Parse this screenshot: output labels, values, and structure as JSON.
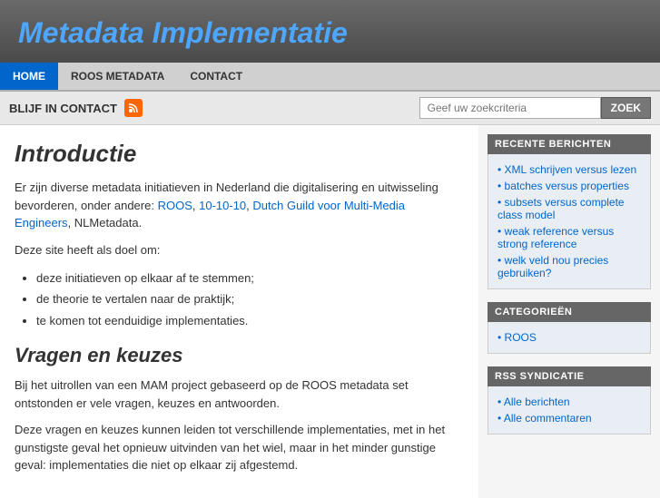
{
  "header": {
    "title": "Metadata Implementatie"
  },
  "nav": {
    "items": [
      {
        "label": "HOME",
        "active": true
      },
      {
        "label": "ROOS METADATA",
        "active": false
      },
      {
        "label": "CONTACT",
        "active": false
      }
    ]
  },
  "toolbar": {
    "stay_in_contact_label": "BLIJF IN CONTACT",
    "search_placeholder": "Geef uw zoekcriteria",
    "search_button_label": "ZOEK"
  },
  "content": {
    "intro_title": "Introductie",
    "intro_para1": "Er zijn diverse metadata initiatieven in Nederland die digitalisering en uitwisseling bevorderen, onder andere:",
    "intro_links": [
      {
        "text": "ROOS",
        "href": "#"
      },
      {
        "text": "10-10-10",
        "href": "#"
      },
      {
        "text": "Dutch Guild voor Multi-Media Engineers",
        "href": "#"
      },
      {
        "text": "NLMetadata",
        "href": "#"
      }
    ],
    "intro_para2": "Deze site heeft als doel om:",
    "intro_list": [
      "deze initiatieven op elkaar af te stemmen;",
      "de theorie te vertalen naar de praktijk;",
      "te komen tot eenduidige implementaties."
    ],
    "section_title": "Vragen en keuzes",
    "section_para1": "Bij het uitrollen van een MAM project gebaseerd op de ROOS metadata set ontstonden er vele vragen, keuzes en antwoorden.",
    "section_para2": "Deze vragen en keuzes kunnen leiden tot verschillende implementaties, met in het gunstigste geval het opnieuw uitvinden van het wiel, maar in het minder gunstige geval: implementaties die niet op elkaar zij afgestemd."
  },
  "sidebar": {
    "recent_posts": {
      "header": "RECENTE BERICHTEN",
      "items": [
        {
          "label": "XML schrijven versus lezen",
          "href": "#"
        },
        {
          "label": "batches versus properties",
          "href": "#"
        },
        {
          "label": "subsets versus complete class model",
          "href": "#"
        },
        {
          "label": "weak reference versus strong reference",
          "href": "#"
        },
        {
          "label": "welk veld nou precies gebruiken?",
          "href": "#"
        }
      ]
    },
    "categories": {
      "header": "CATEGORIEËN",
      "items": [
        {
          "label": "ROOS",
          "href": "#"
        }
      ]
    },
    "rss": {
      "header": "RSS SYNDICATIE",
      "items": [
        {
          "label": "Alle berichten",
          "href": "#"
        },
        {
          "label": "Alle commentaren",
          "href": "#"
        }
      ]
    }
  }
}
